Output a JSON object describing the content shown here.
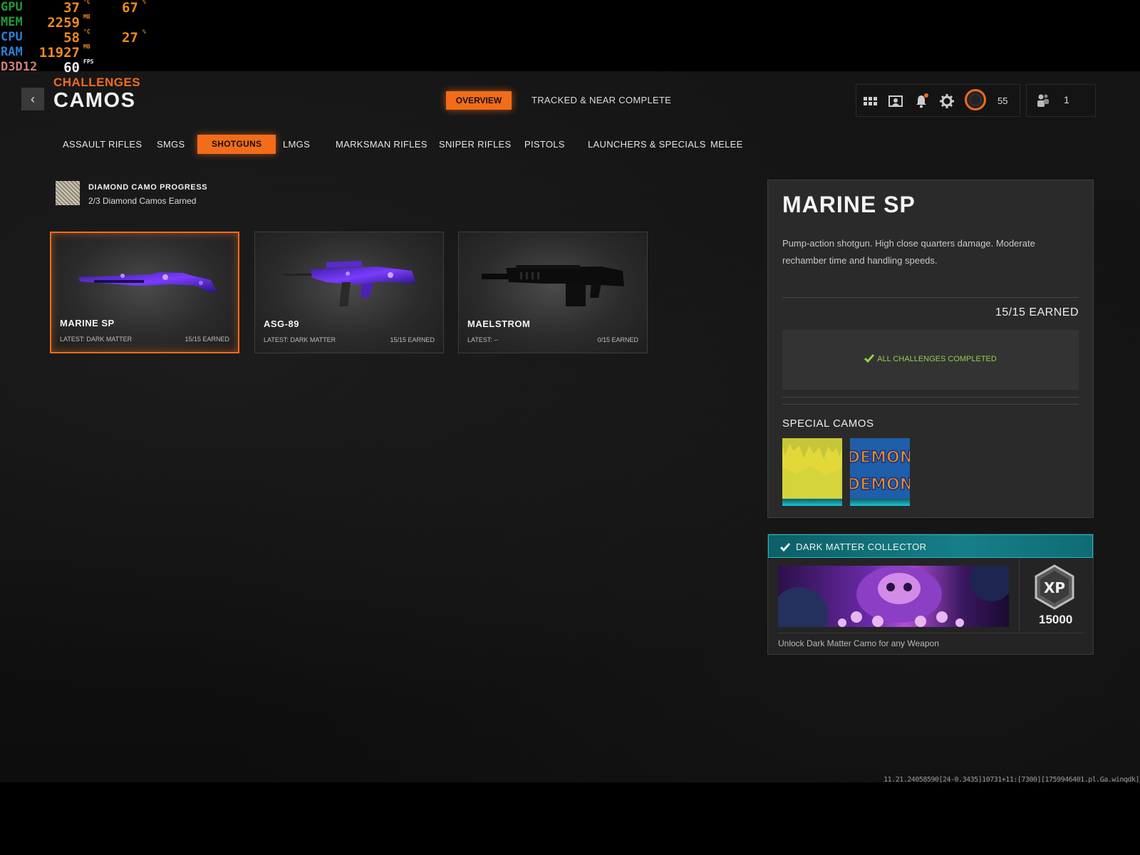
{
  "osd": {
    "rows": [
      {
        "label": "GPU",
        "value": "37",
        "unit": "°C",
        "value2": "67",
        "unit2": "%"
      },
      {
        "label": "MEM",
        "value": "2259",
        "unit": "MB"
      },
      {
        "label": "CPU",
        "value": "58",
        "unit": "°C",
        "value2": "27",
        "unit2": "%"
      },
      {
        "label": "RAM",
        "value": "11927",
        "unit": "MB"
      },
      {
        "label": "D3D12",
        "value": "60",
        "unit": "FPS"
      }
    ],
    "colors": {
      "gpu": "#1f9b3a",
      "mem": "#1f9b3a",
      "cpu": "#2f7fd6",
      "ram": "#2f7fd6",
      "d3d": "#d27f7f",
      "orange": "#f08a1c"
    }
  },
  "header": {
    "back_icon": "‹",
    "breadcrumb": "CHALLENGES",
    "title": "CAMOS",
    "tabs": [
      {
        "label": "OVERVIEW",
        "active": true
      },
      {
        "label": "TRACKED & NEAR COMPLETE",
        "active": false
      }
    ],
    "system": {
      "icons": [
        "grid-icon",
        "map-icon",
        "notification-bell-icon",
        "settings-gear-icon",
        "prestige-emblem-icon"
      ],
      "level": "55",
      "party_icon": "party-members-icon",
      "party_count": "1"
    }
  },
  "categories": [
    {
      "label": "ASSAULT RIFLES",
      "active": false
    },
    {
      "label": "SMGS",
      "active": false
    },
    {
      "label": "SHOTGUNS",
      "active": true
    },
    {
      "label": "LMGS",
      "active": false
    },
    {
      "label": "MARKSMAN RIFLES",
      "active": false
    },
    {
      "label": "SNIPER RIFLES",
      "active": false
    },
    {
      "label": "PISTOLS",
      "active": false
    },
    {
      "label": "LAUNCHERS & SPECIALS",
      "active": false
    },
    {
      "label": "MELEE",
      "active": false
    }
  ],
  "diamond_progress": {
    "title": "DIAMOND CAMO PROGRESS",
    "subtitle": "2/3 Diamond Camos Earned"
  },
  "weapons": [
    {
      "name": "MARINE SP",
      "latest": "LATEST: DARK MATTER",
      "earned": "15/15 EARNED",
      "selected": true,
      "camo": "dark-matter"
    },
    {
      "name": "ASG-89",
      "latest": "LATEST: DARK MATTER",
      "earned": "15/15 EARNED",
      "selected": false,
      "camo": "dark-matter"
    },
    {
      "name": "MAELSTROM",
      "latest": "LATEST: --",
      "earned": "0/15 EARNED",
      "selected": false,
      "camo": "none"
    }
  ],
  "detail": {
    "name": "MARINE SP",
    "description": "Pump-action shotgun.  High close quarters damage. Moderate rechamber time and handling speeds.",
    "earned": "15/15 EARNED",
    "status": "ALL CHALLENGES COMPLETED",
    "special_title": "SPECIAL CAMOS",
    "special_camos": [
      {
        "name": "yellow-drip-camo"
      },
      {
        "name": "demon-camo",
        "overlay_text": "DEMON"
      }
    ]
  },
  "reward": {
    "title": "DARK MATTER COLLECTOR",
    "xp": "15000",
    "description": "Unlock Dark Matter Camo for any Weapon"
  },
  "build_id": "11.21.24058590[24-0.3435]10731+11:[7300][1759946401.pl.Ga.winqdk]",
  "colors": {
    "accent": "#f26c1a",
    "teal": "#157f88",
    "complete_green": "#8fd14f"
  }
}
